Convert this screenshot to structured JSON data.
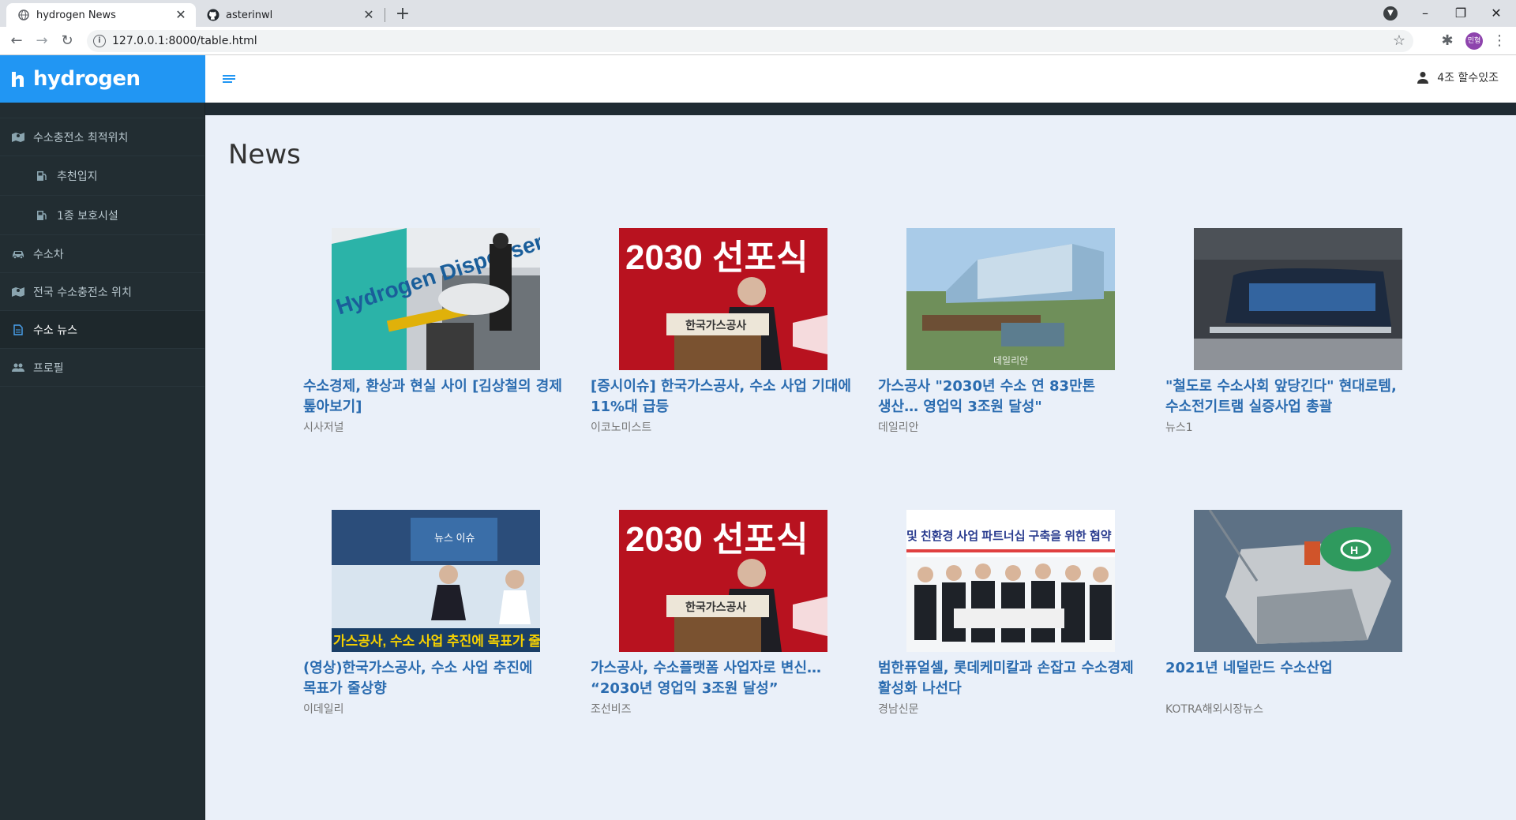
{
  "browser": {
    "tabs": [
      {
        "title": "hydrogen News",
        "close": "✕"
      },
      {
        "title": "asterinwl",
        "close": "✕"
      }
    ],
    "new_tab": "+",
    "url": "127.0.0.1:8000/table.html",
    "profile_initials": "민형",
    "window_controls": {
      "minimize": "–",
      "restore": "❐",
      "close": "✕"
    }
  },
  "app": {
    "brand": "hydrogen",
    "user": "4조 할수있조",
    "page_title": "News"
  },
  "sidebar": {
    "items": [
      {
        "label": "수소충전소 최적위치",
        "icon": "map-icon"
      },
      {
        "label": "추천입지",
        "icon": "gas-station-icon"
      },
      {
        "label": "1종 보호시설",
        "icon": "gas-station-icon"
      },
      {
        "label": "수소차",
        "icon": "car-icon"
      },
      {
        "label": "전국 수소충전소 위치",
        "icon": "map-icon"
      },
      {
        "label": "수소 뉴스",
        "icon": "document-icon"
      },
      {
        "label": "프로필",
        "icon": "users-icon"
      }
    ]
  },
  "news": [
    {
      "headline": "수소경제, 환상과 현실 사이 [김상철의 경제 톺아보기]",
      "source": "시사저널"
    },
    {
      "headline": "[증시이슈] 한국가스공사, 수소 사업 기대에 11%대 급등",
      "source": "이코노미스트"
    },
    {
      "headline": "가스공사 \"2030년 수소 연 83만톤 생산… 영업익 3조원 달성\"",
      "source": "데일리안"
    },
    {
      "headline": "\"철도로 수소사회 앞당긴다\" 현대로템, 수소전기트램 실증사업 총괄",
      "source": "뉴스1"
    },
    {
      "headline": "(영상)한국가스공사, 수소 사업 추진에 목표가 줄상향",
      "source": "이데일리"
    },
    {
      "headline": "가스공사, 수소플랫폼 사업자로 변신… “2030년 영업익 3조원 달성”",
      "source": "조선비즈"
    },
    {
      "headline": "범한퓨얼셀, 롯데케미칼과 손잡고 수소경제 활성화 나선다",
      "source": "경남신문"
    },
    {
      "headline": "2021년 네덜란드 수소산업",
      "source": "KOTRA해외시장뉴스"
    }
  ],
  "thumb_text": {
    "t1": "Hydrogen Dispenser",
    "t2_big": "2030 선포식",
    "t2_podium": "한국가스공사",
    "t3_watermark": "데일리안",
    "t5_caption": "가스공사, 수소 사업 추진에 목표가 줄상",
    "t5_screen": "뉴스 이슈",
    "t6_big": "2030 선포식",
    "t6_podium": "한국가스공사",
    "t7_banner": "및 친환경 사업 파트너십 구축을 위한 협약 체결"
  },
  "colors": {
    "brand": "#2196f3",
    "sidebar_bg": "#222d32",
    "link": "#2b6cb0",
    "content_bg": "#eaf0f9"
  }
}
